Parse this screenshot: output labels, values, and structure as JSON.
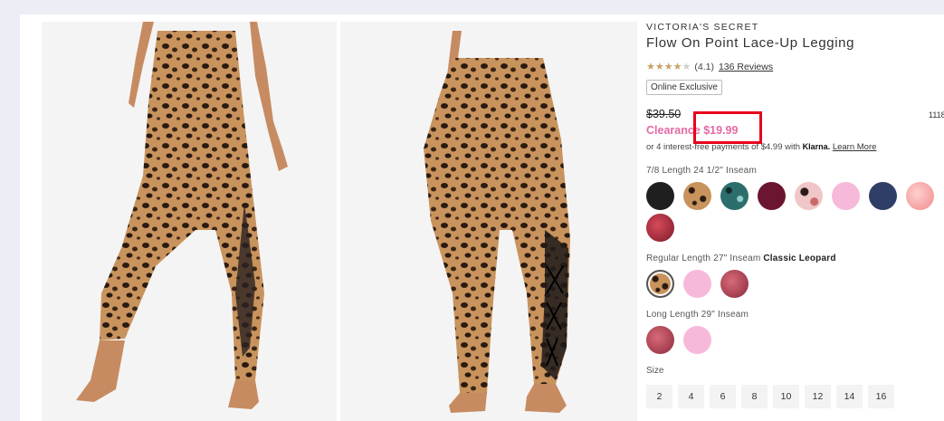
{
  "product": {
    "brand": "VICTORIA'S SECRET",
    "title": "Flow On Point Lace-Up Legging",
    "rating_value": "(4.1)",
    "rating_stars": 4.1,
    "reviews_link": "136 Reviews",
    "badge": "Online Exclusive",
    "price_original": "$39.50",
    "price_clearance": "Clearance $19.99",
    "sku_fragment": "1118",
    "klarna_text": "or 4 interest-free payments of $4.99 with",
    "klarna_brand": "Klarna.",
    "klarna_link": "Learn More"
  },
  "colors": {
    "accent_pink": "#e46aa4",
    "highlight_red": "#e8001c",
    "star_gold": "#c9a267"
  },
  "swatch_groups": [
    {
      "label": "7/8 Length 24 1/2\" Inseam",
      "selected_name": "",
      "swatches": [
        "#1f1f1f",
        "leopard",
        "teal-leopard",
        "#6b1530",
        "pink-floral",
        "#f7b9da",
        "#2f3e66",
        "blush-tiedye",
        "red-tiedye"
      ]
    },
    {
      "label": "Regular Length 27\" Inseam",
      "selected_name": "Classic Leopard",
      "swatches": [
        "leopard",
        "#f7b9da",
        "berry-tiedye"
      ]
    },
    {
      "label": "Long Length 29\" Inseam",
      "selected_name": "",
      "swatches": [
        "berry-tiedye",
        "#f7b9da"
      ]
    }
  ],
  "sizes": {
    "label": "Size",
    "options": [
      "2",
      "4",
      "6",
      "8",
      "10",
      "12",
      "14",
      "16"
    ]
  }
}
